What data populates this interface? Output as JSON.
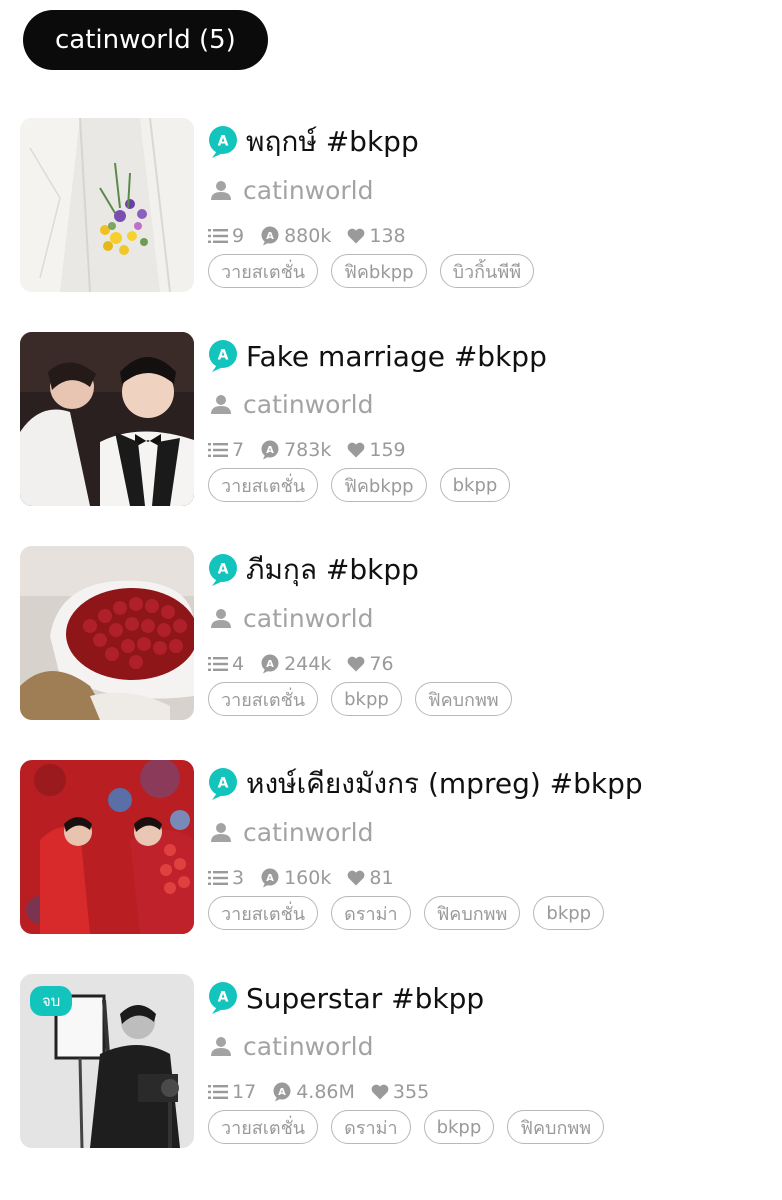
{
  "header": {
    "label": "catinworld (5)"
  },
  "stories": [
    {
      "title": "พฤกษ์ #bkpp",
      "author": "catinworld",
      "chapters": "9",
      "views": "880k",
      "likes": "138",
      "tags": [
        "วายสเตชั่น",
        "ฟิคbkpp",
        "บิวกิ้นพีพี"
      ],
      "badge": ""
    },
    {
      "title": "Fake marriage #bkpp",
      "author": "catinworld",
      "chapters": "7",
      "views": "783k",
      "likes": "159",
      "tags": [
        "วายสเตชั่น",
        "ฟิคbkpp",
        "bkpp"
      ],
      "badge": ""
    },
    {
      "title": "ภีมกุล #bkpp",
      "author": "catinworld",
      "chapters": "4",
      "views": "244k",
      "likes": "76",
      "tags": [
        "วายสเตชั่น",
        "bkpp",
        "ฟิคบกพพ"
      ],
      "badge": ""
    },
    {
      "title": "หงษ์เคียงมังกร (mpreg) #bkpp",
      "author": "catinworld",
      "chapters": "3",
      "views": "160k",
      "likes": "81",
      "tags": [
        "วายสเตชั่น",
        "ดราม่า",
        "ฟิคบกพพ",
        "bkpp"
      ],
      "badge": ""
    },
    {
      "title": "Superstar #bkpp",
      "author": "catinworld",
      "chapters": "17",
      "views": "4.86M",
      "likes": "355",
      "tags": [
        "วายสเตชั่น",
        "ดราม่า",
        "bkpp",
        "ฟิคบกพพ"
      ],
      "badge": "จบ"
    }
  ],
  "colors": {
    "accent": "#13c4bc",
    "muted": "#9a9a9a",
    "pill": "#0b0b0b"
  },
  "icons": {
    "title": "app-logo-icon",
    "author": "user-icon",
    "chapters": "list-icon",
    "views": "views-icon",
    "likes": "heart-icon"
  }
}
